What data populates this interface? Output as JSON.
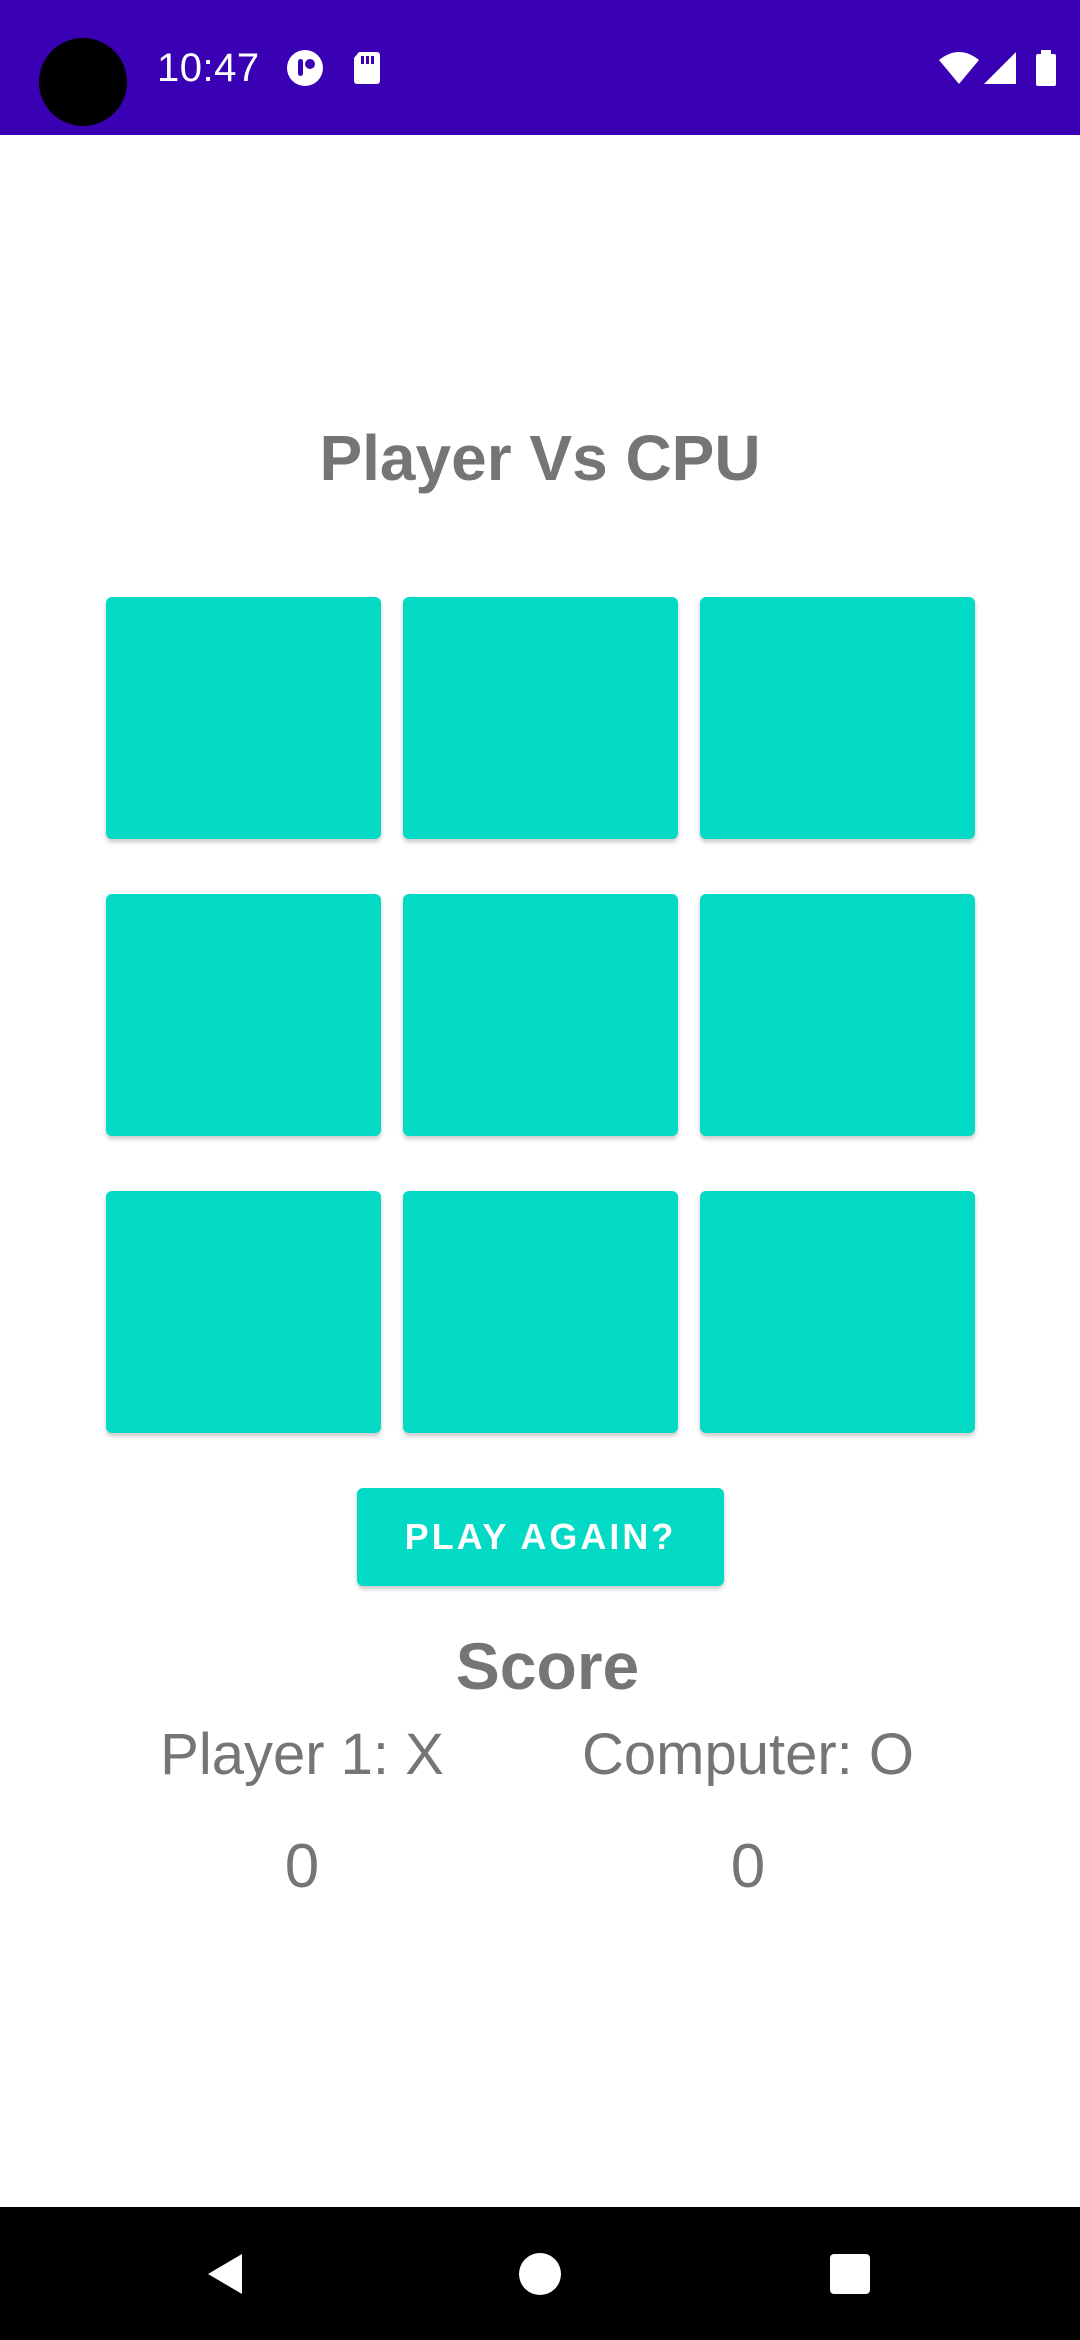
{
  "status_bar": {
    "time": "10:47",
    "icons": [
      "notification-app-icon",
      "sd-card-icon",
      "wifi-icon",
      "cell-signal-icon",
      "battery-icon"
    ],
    "background_color": "#3a00b3"
  },
  "game": {
    "title": "Player Vs CPU",
    "board": [
      [
        "",
        "",
        ""
      ],
      [
        "",
        "",
        ""
      ],
      [
        "",
        "",
        ""
      ]
    ],
    "cell_color": "#03dac5",
    "play_again_label": "PLAY AGAIN?"
  },
  "score": {
    "heading": "Score",
    "player_label": "Player 1: X",
    "computer_label": "Computer: O",
    "player_score": "0",
    "computer_score": "0"
  },
  "nav_bar": {
    "buttons": [
      "back-icon",
      "home-icon",
      "recents-icon"
    ]
  }
}
